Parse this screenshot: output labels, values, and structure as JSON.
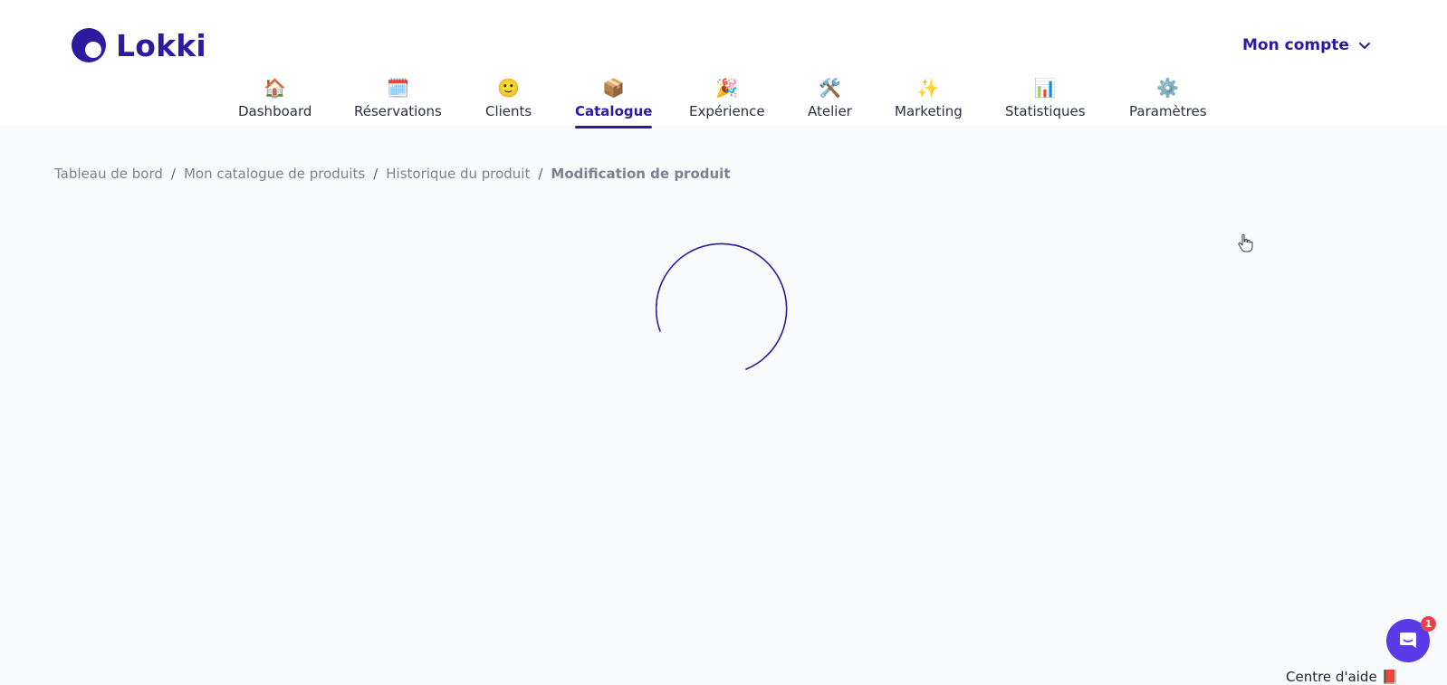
{
  "app": {
    "logo_text": "Lokki",
    "account_label": "Mon compte"
  },
  "nav": {
    "items": [
      {
        "label": "Dashboard",
        "icon": "🏠",
        "icon_name": "house-icon"
      },
      {
        "label": "Réservations",
        "icon": "🗓️",
        "icon_name": "calendar-icon"
      },
      {
        "label": "Clients",
        "icon": "🙂",
        "icon_name": "smiley-icon"
      },
      {
        "label": "Catalogue",
        "icon": "📦",
        "icon_name": "package-icon",
        "active": true
      },
      {
        "label": "Expérience",
        "icon": "🎉",
        "icon_name": "party-popper-icon"
      },
      {
        "label": "Atelier",
        "icon": "🛠️",
        "icon_name": "tools-icon"
      },
      {
        "label": "Marketing",
        "icon": "✨",
        "icon_name": "sparkles-icon"
      },
      {
        "label": "Statistiques",
        "icon": "📊",
        "icon_name": "bar-chart-icon"
      },
      {
        "label": "Paramètres",
        "icon": "⚙️",
        "icon_name": "gear-icon"
      }
    ]
  },
  "breadcrumb": {
    "items": [
      "Tableau de bord",
      "Mon catalogue de produits",
      "Historique du produit"
    ],
    "current": "Modification de produit",
    "separator": "/"
  },
  "chat": {
    "badge_count": "1"
  },
  "footer": {
    "help_label": "Centre d'aide",
    "help_icon": "📕"
  },
  "colors": {
    "brand": "#2e1a9e",
    "chat": "#5b3ae8",
    "badge": "#e8414d",
    "background": "#f9fafc"
  }
}
